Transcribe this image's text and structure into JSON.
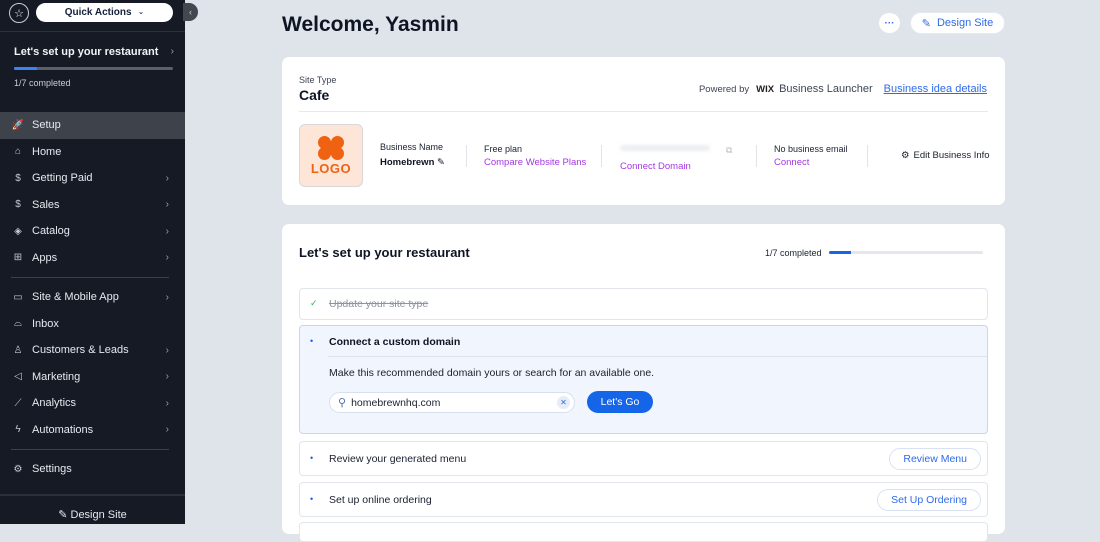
{
  "sidebar": {
    "quick_actions": "Quick Actions",
    "setup_card": {
      "title": "Let's set up your restaurant",
      "progress_text": "1/7 completed",
      "progress_fraction": 0.143
    },
    "items": [
      {
        "label": "Setup",
        "icon": "rocket-icon",
        "glyph": "🚀",
        "has_chevron": false,
        "active": true
      },
      {
        "label": "Home",
        "icon": "home-icon",
        "glyph": "⌂",
        "has_chevron": false
      },
      {
        "label": "Getting Paid",
        "icon": "invoice-dollar-icon",
        "glyph": "$",
        "has_chevron": true
      },
      {
        "label": "Sales",
        "icon": "dollar-circle-icon",
        "glyph": "$",
        "has_chevron": true
      },
      {
        "label": "Catalog",
        "icon": "catalog-icon",
        "glyph": "◈",
        "has_chevron": true
      },
      {
        "label": "Apps",
        "icon": "apps-icon",
        "glyph": "⊞",
        "has_chevron": true
      },
      {
        "label": "Site & Mobile App",
        "icon": "devices-icon",
        "glyph": "▭",
        "has_chevron": true
      },
      {
        "label": "Inbox",
        "icon": "inbox-icon",
        "glyph": "⌓",
        "has_chevron": false
      },
      {
        "label": "Customers & Leads",
        "icon": "customers-icon",
        "glyph": "♙",
        "has_chevron": true
      },
      {
        "label": "Marketing",
        "icon": "megaphone-icon",
        "glyph": "◁",
        "has_chevron": true
      },
      {
        "label": "Analytics",
        "icon": "analytics-icon",
        "glyph": "⟋",
        "has_chevron": true
      },
      {
        "label": "Automations",
        "icon": "lightning-icon",
        "glyph": "ϟ",
        "has_chevron": true
      },
      {
        "label": "Settings",
        "icon": "gear-icon",
        "glyph": "⚙",
        "has_chevron": false
      }
    ],
    "design_site": "Design Site"
  },
  "header": {
    "welcome": "Welcome, Yasmin",
    "more_label": "···",
    "design_site": "Design Site"
  },
  "business_card": {
    "site_type_label": "Site Type",
    "site_type_value": "Cafe",
    "powered_by": "Powered by",
    "wix": "WIX",
    "launcher": "Business Launcher",
    "idea_link": "Business idea details",
    "logo_text": "LOGO",
    "business_name_label": "Business Name",
    "business_name": "Homebrewn",
    "plan_label": "Free plan",
    "plan_link": "Compare Website Plans",
    "domain_link": "Connect Domain",
    "email_label": "No business email",
    "email_link": "Connect",
    "edit_info": "Edit Business Info"
  },
  "setup": {
    "title": "Let's set up your restaurant",
    "progress_text": "1/7 completed",
    "progress_fraction": 0.143,
    "tasks": [
      {
        "label": "Update your site type",
        "done": true
      },
      {
        "label": "Connect a custom domain",
        "done": false,
        "expanded": true,
        "description": "Make this recommended domain yours or search for an available one.",
        "input_value": "homebrewnhq.com",
        "button": "Let's Go"
      },
      {
        "label": "Review your generated menu",
        "done": false,
        "button": "Review Menu"
      },
      {
        "label": "Set up online ordering",
        "done": false,
        "button": "Set Up Ordering"
      }
    ]
  }
}
